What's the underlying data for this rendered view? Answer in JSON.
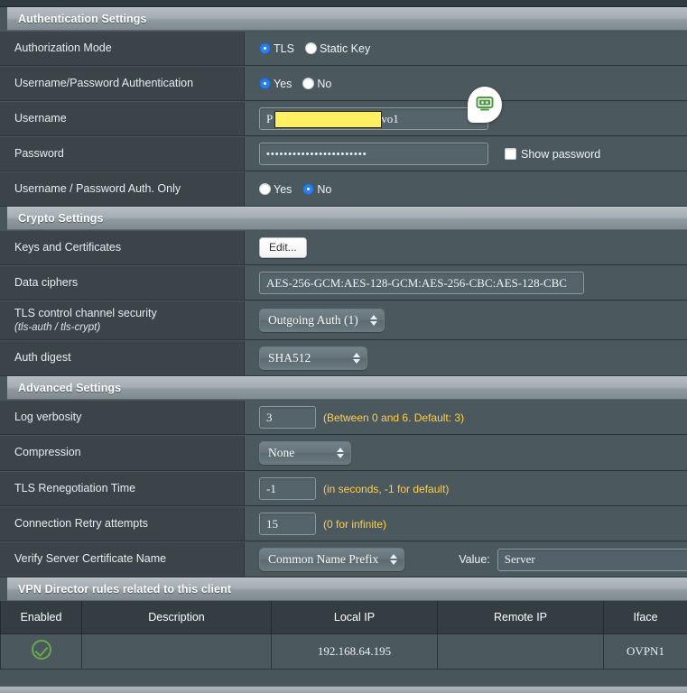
{
  "sections": {
    "authentication": {
      "title": "Authentication Settings",
      "rows": {
        "authorization_mode": {
          "label": "Authorization Mode",
          "options": [
            "TLS",
            "Static Key"
          ],
          "selected": "TLS"
        },
        "userpass_auth": {
          "label": "Username/Password Authentication",
          "options": [
            "Yes",
            "No"
          ],
          "selected": "Yes"
        },
        "username": {
          "label": "Username",
          "value_prefix": "P",
          "value_suffix": "vo1",
          "redacted": true
        },
        "password": {
          "label": "Password",
          "value": "•••••••••••••••••••••••",
          "show_password_label": "Show password",
          "show_password_checked": false
        },
        "userpass_only": {
          "label": "Username / Password Auth. Only",
          "options": [
            "Yes",
            "No"
          ],
          "selected": "No"
        }
      }
    },
    "crypto": {
      "title": "Crypto Settings",
      "rows": {
        "keys_certs": {
          "label": "Keys and Certificates",
          "button_label": "Edit..."
        },
        "data_ciphers": {
          "label": "Data ciphers",
          "value": "AES-256-GCM:AES-128-GCM:AES-256-CBC:AES-128-CBC"
        },
        "tls_control": {
          "label": "TLS control channel security",
          "label_sub": "(tls-auth / tls-crypt)",
          "selected": "Outgoing Auth (1)"
        },
        "auth_digest": {
          "label": "Auth digest",
          "selected": "SHA512"
        }
      }
    },
    "advanced": {
      "title": "Advanced Settings",
      "rows": {
        "log_verbosity": {
          "label": "Log verbosity",
          "value": "3",
          "hint": "(Between 0 and 6. Default: 3)"
        },
        "compression": {
          "label": "Compression",
          "selected": "None"
        },
        "tls_renegotiation": {
          "label": "TLS Renegotiation Time",
          "value": "-1",
          "hint": "(in seconds, -1 for default)"
        },
        "retry_attempts": {
          "label": "Connection Retry attempts",
          "value": "15",
          "hint": "(0 for infinite)"
        },
        "verify_server_cert": {
          "label": "Verify Server Certificate Name",
          "selected": "Common Name Prefix",
          "value_label": "Value:",
          "value": "Server"
        }
      }
    },
    "vpn_director": {
      "title": "VPN Director rules related to this client",
      "columns": [
        "Enabled",
        "Description",
        "Local IP",
        "Remote IP",
        "Iface"
      ],
      "rows": [
        {
          "enabled": true,
          "description": "",
          "local_ip": "192.168.64.195",
          "remote_ip": "",
          "iface": "OVPN1"
        }
      ]
    }
  },
  "overlay": {
    "bot_badge": "robot-assistant-icon"
  },
  "colors": {
    "accent_blue": "#2a7fe8",
    "hint_yellow": "#ffcf4a",
    "redaction_yellow": "#ffef62",
    "ok_green": "#6aa84f",
    "panel_dark": "#3b4549",
    "panel_light": "#4b585d"
  }
}
